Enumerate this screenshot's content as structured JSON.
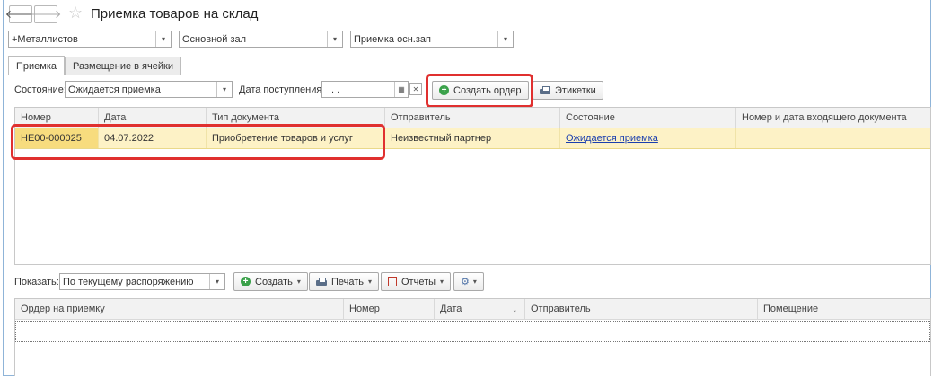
{
  "window": {
    "title": "Приемка товаров на склад"
  },
  "nav": {
    "back_icon": "arrow-left-icon",
    "forward_icon": "arrow-right-icon",
    "star": "☆"
  },
  "filters": [
    {
      "value": "+Металлистов"
    },
    {
      "value": "Основной зал"
    },
    {
      "value": "Приемка осн.зап"
    }
  ],
  "tabs": [
    {
      "label": "Приемка",
      "active": true
    },
    {
      "label": "Размещение в ячейки",
      "active": false
    }
  ],
  "toolbar": {
    "status_label": "Состояние:",
    "status_value": "Ожидается приемка",
    "date_label": "Дата поступления:",
    "date_value": ". .",
    "create_order": "Создать ордер",
    "labels": "Этикетки"
  },
  "table": {
    "columns": [
      "Номер",
      "Дата",
      "Тип документа",
      "Отправитель",
      "Состояние",
      "Номер и дата входящего документа"
    ],
    "rows": [
      {
        "number": "НЕ00-000025",
        "date": "04.07.2022",
        "type": "Приобретение товаров и услуг",
        "sender": "Неизвестный партнер",
        "state": "Ожидается приемка",
        "incoming": ""
      }
    ]
  },
  "bottom": {
    "show_label": "Показать:",
    "show_value": "По текущему распоряжению",
    "create": "Создать",
    "print": "Печать",
    "reports": "Отчеты",
    "columns": [
      "Ордер на приемку",
      "Номер",
      "Дата",
      "↓",
      "Отправитель",
      "Помещение"
    ]
  },
  "colors": {
    "highlight": "#e0302f",
    "row_selected": "#fdf2c6",
    "accent_green": "#3aa14a"
  }
}
